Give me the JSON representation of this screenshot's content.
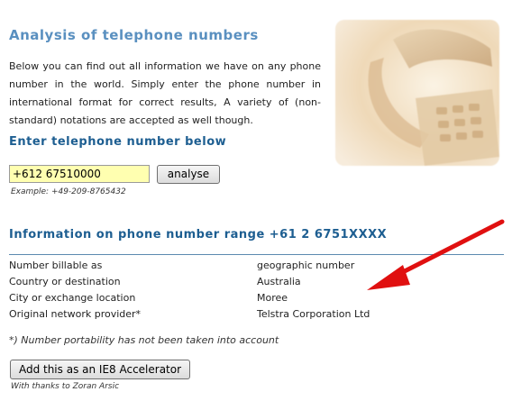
{
  "header": {
    "title": "Analysis of telephone numbers",
    "intro": "Below you can find out all information we have on any phone number in the world. Simply enter the phone number in international format for correct results, A variety of (non-standard) notations are accepted as well though."
  },
  "form": {
    "heading": "Enter telephone number below",
    "phone_value": "+612 67510000",
    "analyse_label": "analyse",
    "example": "Example: +49-209-8765432"
  },
  "results": {
    "heading": "Information on phone number range +61 2 6751XXXX",
    "rows": [
      {
        "label": "Number billable as",
        "value": "geographic number"
      },
      {
        "label": "Country or destination",
        "value": "Australia"
      },
      {
        "label": "City or exchange location",
        "value": "Moree"
      },
      {
        "label": "Original network provider*",
        "value": "Telstra Corporation Ltd"
      }
    ],
    "footnote": "*) Number portability has not been taken into account"
  },
  "footer": {
    "accelerator_label": "Add this as an IE8 Accelerator",
    "thanks": "With thanks to Zoran Arsic"
  },
  "colors": {
    "heading": "#5a90c0",
    "subheading": "#1d5e91",
    "input_bg": "#ffffb0",
    "arrow": "#e01010"
  },
  "icons": {
    "photo": "telephone-photo",
    "annotation": "red-arrow"
  }
}
